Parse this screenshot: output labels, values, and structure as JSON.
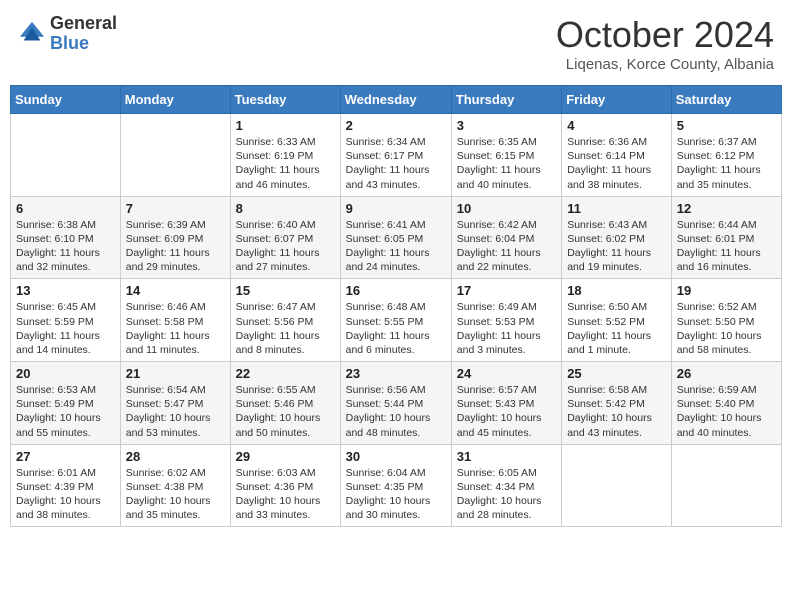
{
  "header": {
    "logo_general": "General",
    "logo_blue": "Blue",
    "title": "October 2024",
    "location": "Liqenas, Korce County, Albania"
  },
  "weekdays": [
    "Sunday",
    "Monday",
    "Tuesday",
    "Wednesday",
    "Thursday",
    "Friday",
    "Saturday"
  ],
  "weeks": [
    [
      {
        "day": "",
        "sunrise": "",
        "sunset": "",
        "daylight": ""
      },
      {
        "day": "",
        "sunrise": "",
        "sunset": "",
        "daylight": ""
      },
      {
        "day": "1",
        "sunrise": "Sunrise: 6:33 AM",
        "sunset": "Sunset: 6:19 PM",
        "daylight": "Daylight: 11 hours and 46 minutes."
      },
      {
        "day": "2",
        "sunrise": "Sunrise: 6:34 AM",
        "sunset": "Sunset: 6:17 PM",
        "daylight": "Daylight: 11 hours and 43 minutes."
      },
      {
        "day": "3",
        "sunrise": "Sunrise: 6:35 AM",
        "sunset": "Sunset: 6:15 PM",
        "daylight": "Daylight: 11 hours and 40 minutes."
      },
      {
        "day": "4",
        "sunrise": "Sunrise: 6:36 AM",
        "sunset": "Sunset: 6:14 PM",
        "daylight": "Daylight: 11 hours and 38 minutes."
      },
      {
        "day": "5",
        "sunrise": "Sunrise: 6:37 AM",
        "sunset": "Sunset: 6:12 PM",
        "daylight": "Daylight: 11 hours and 35 minutes."
      }
    ],
    [
      {
        "day": "6",
        "sunrise": "Sunrise: 6:38 AM",
        "sunset": "Sunset: 6:10 PM",
        "daylight": "Daylight: 11 hours and 32 minutes."
      },
      {
        "day": "7",
        "sunrise": "Sunrise: 6:39 AM",
        "sunset": "Sunset: 6:09 PM",
        "daylight": "Daylight: 11 hours and 29 minutes."
      },
      {
        "day": "8",
        "sunrise": "Sunrise: 6:40 AM",
        "sunset": "Sunset: 6:07 PM",
        "daylight": "Daylight: 11 hours and 27 minutes."
      },
      {
        "day": "9",
        "sunrise": "Sunrise: 6:41 AM",
        "sunset": "Sunset: 6:05 PM",
        "daylight": "Daylight: 11 hours and 24 minutes."
      },
      {
        "day": "10",
        "sunrise": "Sunrise: 6:42 AM",
        "sunset": "Sunset: 6:04 PM",
        "daylight": "Daylight: 11 hours and 22 minutes."
      },
      {
        "day": "11",
        "sunrise": "Sunrise: 6:43 AM",
        "sunset": "Sunset: 6:02 PM",
        "daylight": "Daylight: 11 hours and 19 minutes."
      },
      {
        "day": "12",
        "sunrise": "Sunrise: 6:44 AM",
        "sunset": "Sunset: 6:01 PM",
        "daylight": "Daylight: 11 hours and 16 minutes."
      }
    ],
    [
      {
        "day": "13",
        "sunrise": "Sunrise: 6:45 AM",
        "sunset": "Sunset: 5:59 PM",
        "daylight": "Daylight: 11 hours and 14 minutes."
      },
      {
        "day": "14",
        "sunrise": "Sunrise: 6:46 AM",
        "sunset": "Sunset: 5:58 PM",
        "daylight": "Daylight: 11 hours and 11 minutes."
      },
      {
        "day": "15",
        "sunrise": "Sunrise: 6:47 AM",
        "sunset": "Sunset: 5:56 PM",
        "daylight": "Daylight: 11 hours and 8 minutes."
      },
      {
        "day": "16",
        "sunrise": "Sunrise: 6:48 AM",
        "sunset": "Sunset: 5:55 PM",
        "daylight": "Daylight: 11 hours and 6 minutes."
      },
      {
        "day": "17",
        "sunrise": "Sunrise: 6:49 AM",
        "sunset": "Sunset: 5:53 PM",
        "daylight": "Daylight: 11 hours and 3 minutes."
      },
      {
        "day": "18",
        "sunrise": "Sunrise: 6:50 AM",
        "sunset": "Sunset: 5:52 PM",
        "daylight": "Daylight: 11 hours and 1 minute."
      },
      {
        "day": "19",
        "sunrise": "Sunrise: 6:52 AM",
        "sunset": "Sunset: 5:50 PM",
        "daylight": "Daylight: 10 hours and 58 minutes."
      }
    ],
    [
      {
        "day": "20",
        "sunrise": "Sunrise: 6:53 AM",
        "sunset": "Sunset: 5:49 PM",
        "daylight": "Daylight: 10 hours and 55 minutes."
      },
      {
        "day": "21",
        "sunrise": "Sunrise: 6:54 AM",
        "sunset": "Sunset: 5:47 PM",
        "daylight": "Daylight: 10 hours and 53 minutes."
      },
      {
        "day": "22",
        "sunrise": "Sunrise: 6:55 AM",
        "sunset": "Sunset: 5:46 PM",
        "daylight": "Daylight: 10 hours and 50 minutes."
      },
      {
        "day": "23",
        "sunrise": "Sunrise: 6:56 AM",
        "sunset": "Sunset: 5:44 PM",
        "daylight": "Daylight: 10 hours and 48 minutes."
      },
      {
        "day": "24",
        "sunrise": "Sunrise: 6:57 AM",
        "sunset": "Sunset: 5:43 PM",
        "daylight": "Daylight: 10 hours and 45 minutes."
      },
      {
        "day": "25",
        "sunrise": "Sunrise: 6:58 AM",
        "sunset": "Sunset: 5:42 PM",
        "daylight": "Daylight: 10 hours and 43 minutes."
      },
      {
        "day": "26",
        "sunrise": "Sunrise: 6:59 AM",
        "sunset": "Sunset: 5:40 PM",
        "daylight": "Daylight: 10 hours and 40 minutes."
      }
    ],
    [
      {
        "day": "27",
        "sunrise": "Sunrise: 6:01 AM",
        "sunset": "Sunset: 4:39 PM",
        "daylight": "Daylight: 10 hours and 38 minutes."
      },
      {
        "day": "28",
        "sunrise": "Sunrise: 6:02 AM",
        "sunset": "Sunset: 4:38 PM",
        "daylight": "Daylight: 10 hours and 35 minutes."
      },
      {
        "day": "29",
        "sunrise": "Sunrise: 6:03 AM",
        "sunset": "Sunset: 4:36 PM",
        "daylight": "Daylight: 10 hours and 33 minutes."
      },
      {
        "day": "30",
        "sunrise": "Sunrise: 6:04 AM",
        "sunset": "Sunset: 4:35 PM",
        "daylight": "Daylight: 10 hours and 30 minutes."
      },
      {
        "day": "31",
        "sunrise": "Sunrise: 6:05 AM",
        "sunset": "Sunset: 4:34 PM",
        "daylight": "Daylight: 10 hours and 28 minutes."
      },
      {
        "day": "",
        "sunrise": "",
        "sunset": "",
        "daylight": ""
      },
      {
        "day": "",
        "sunrise": "",
        "sunset": "",
        "daylight": ""
      }
    ]
  ]
}
